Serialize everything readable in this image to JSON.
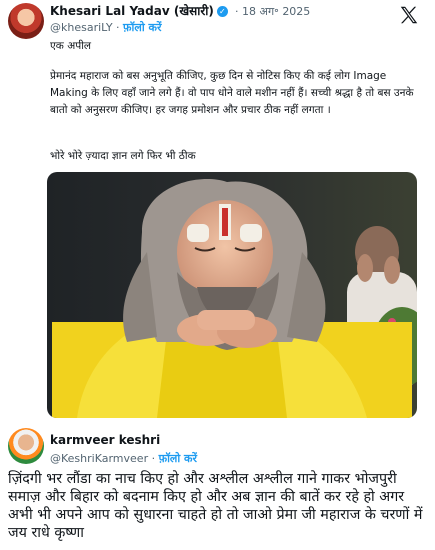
{
  "post": {
    "author": "Khesari Lal Yadav (खेसारी)",
    "handle": "@khesariLY",
    "dot": "·",
    "follow": "फ़ॉलो करें",
    "time": "· 18 अग॰ 2025",
    "line1": "एक अपील",
    "para1": "प्रेमानंद महाराज को बस अनुभूति कीजिए, कुछ दिन से नोटिस किए की कई लोग Image Making के लिए वहाँ जाने लगे हैं। वो पाप धोने वाले मशीन नहीं हैं। सच्ची श्रद्धा है तो बस उनके बातो को अनुसरण कीजिए। हर जगह प्रमोशन और प्रचार ठीक नहीं लगता ।",
    "para2": "भोरे भोरे ज़्यादा ज्ञान लगे फिर भी ठीक"
  },
  "reply": {
    "author": "karmveer keshri",
    "handle": "@KeshriKarmveer",
    "dot": "·",
    "follow": "फ़ॉलो करें",
    "text": "ज़िंदगी भर लौंडा का नाच किए हो और अश्लील अश्लील गाने गाकर भोजपुरी समाज़ और बिहार को बदनाम किए हो और अब ज्ञान की बातें कर रहे हो अगर अभी भी अपने आप को सुधारना चाहते हो तो जाओ प्रेमा जी महाराज के चरणों में जय राधे कृष्णा"
  },
  "icons": {
    "verified": "verified-badge-icon",
    "x_logo": "x-logo-icon"
  },
  "colors": {
    "link": "#1d9bf0",
    "secondary": "#536471",
    "text": "#0f1419"
  }
}
